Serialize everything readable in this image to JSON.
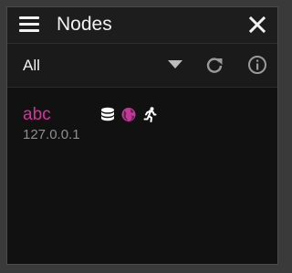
{
  "header": {
    "title": "Nodes",
    "menu_icon": "hamburger-menu-icon",
    "close_icon": "close-icon"
  },
  "filter": {
    "selected": "All",
    "dropdown_icon": "chevron-down-icon",
    "refresh_icon": "refresh-icon",
    "info_icon": "info-icon"
  },
  "nodes": [
    {
      "name": "abc",
      "address": "127.0.0.1",
      "icons": [
        "database-icon",
        "globe-icon",
        "running-person-icon"
      ]
    }
  ],
  "colors": {
    "accent": "#d6339a",
    "title_bg": "#1d1d1e",
    "panel_bg": "#111112",
    "secondary_text": "#8e8e8e"
  }
}
